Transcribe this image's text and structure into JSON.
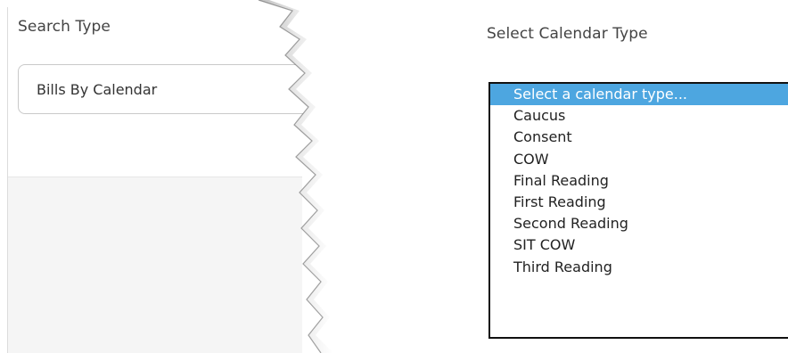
{
  "search_type": {
    "label": "Search Type",
    "selected_value": "Bills By Calendar"
  },
  "calendar_type": {
    "label": "Select Calendar Type",
    "options": [
      "Select a calendar type...",
      "Caucus",
      "Consent",
      "COW",
      "Final Reading",
      "First Reading",
      "Second Reading",
      "SIT COW",
      "Third Reading"
    ],
    "selected_index": 0
  },
  "colors": {
    "highlight": "#4da6e0",
    "background": "#f5f5f5"
  },
  "icons": {
    "dropdown": "chevron-down-icon"
  }
}
